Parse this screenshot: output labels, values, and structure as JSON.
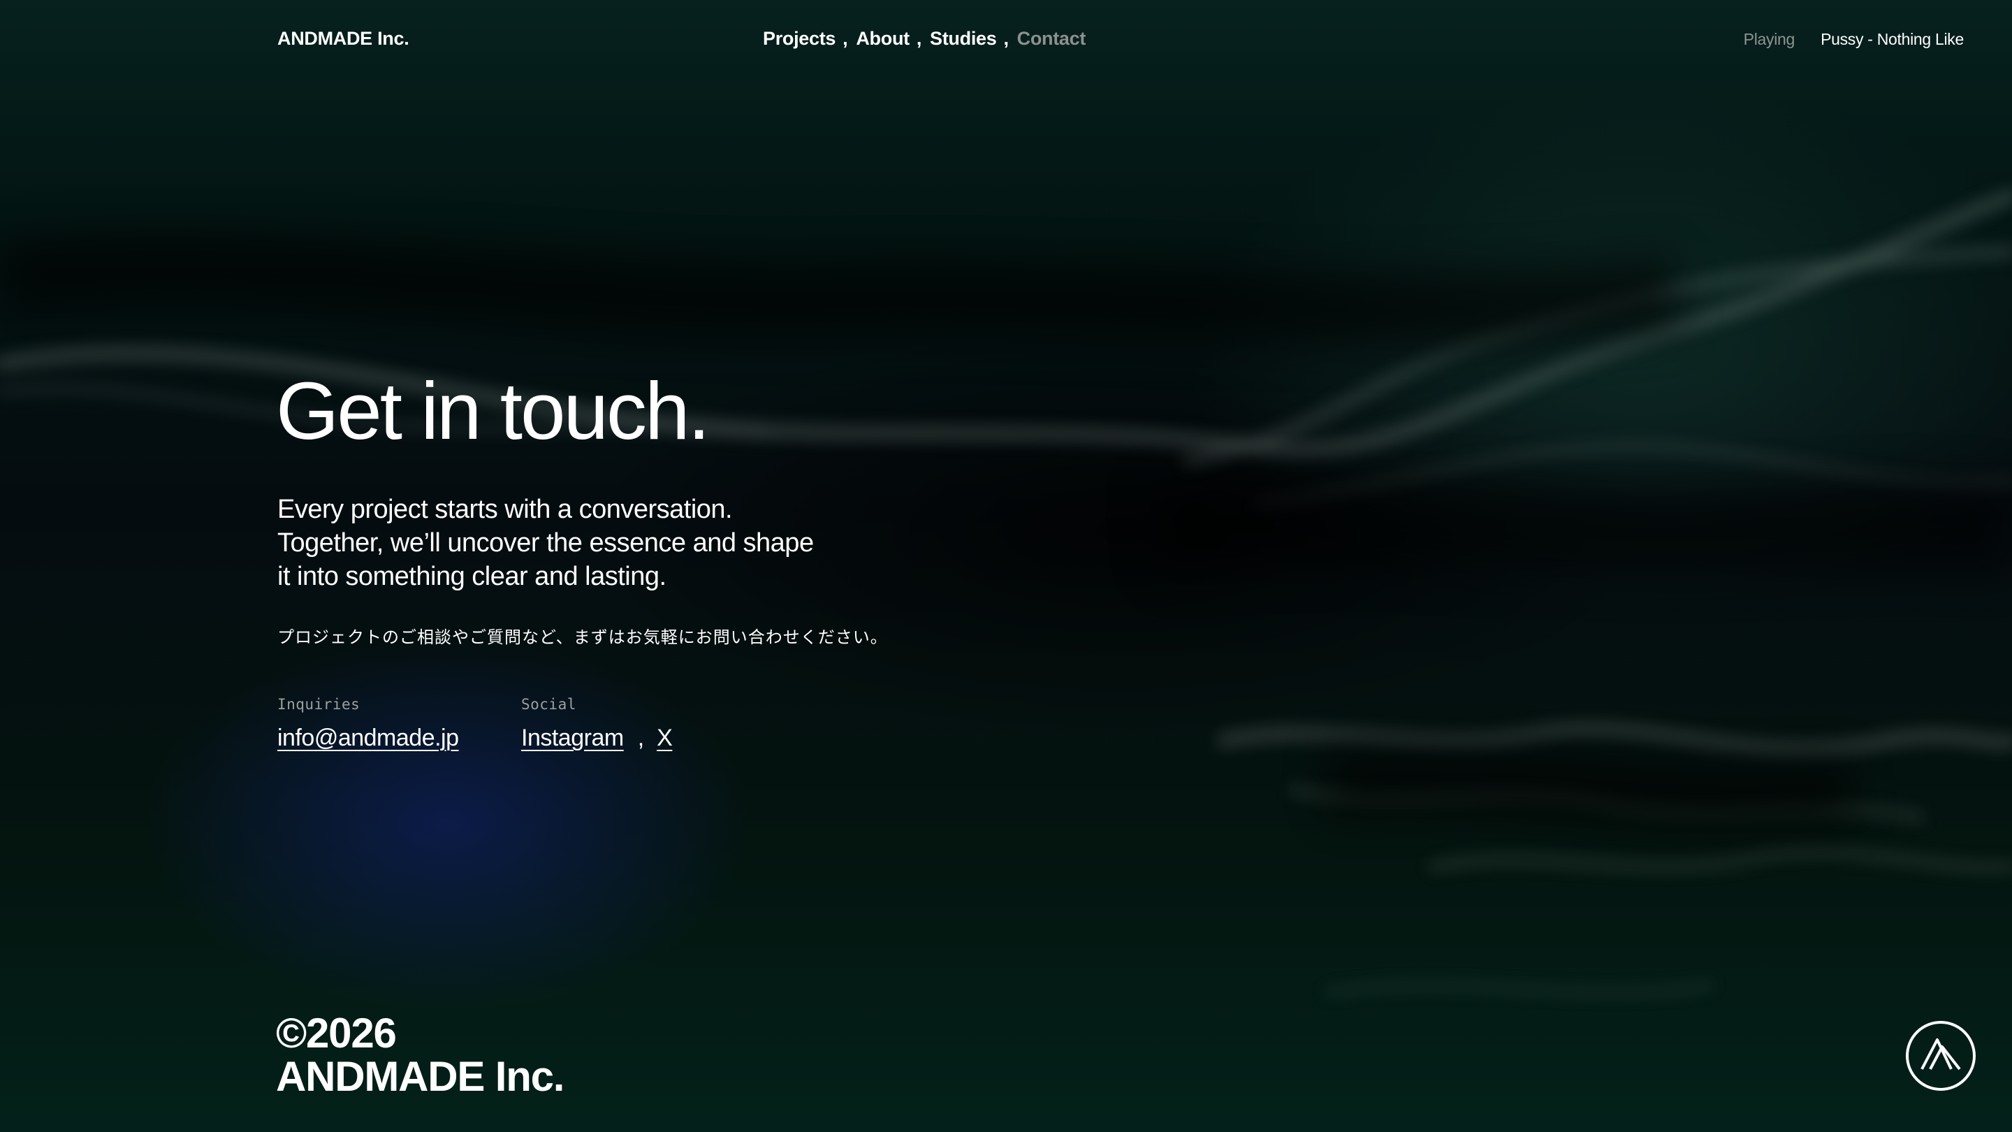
{
  "header": {
    "logo": "ANDMADE Inc.",
    "nav": [
      {
        "label": "Projects"
      },
      {
        "label": "About"
      },
      {
        "label": "Studies"
      },
      {
        "label": "Contact"
      }
    ],
    "nav_separator": ",",
    "player": {
      "label": "Playing",
      "track": "Pussy - Nothing Like"
    }
  },
  "main": {
    "headline": "Get in touch.",
    "lead": [
      "Every project starts with a conversation.",
      "Together, we’ll uncover the essence and shape",
      "it into something clear and lasting."
    ],
    "jp_text": "プロジェクトのご相談やご質問など、まずはお気軽にお問い合わせください。",
    "inquiries": {
      "caption": "Inquiries",
      "email": "info@andmade.jp"
    },
    "social": {
      "caption": "Social",
      "links": [
        "Instagram",
        "X"
      ],
      "separator": ","
    }
  },
  "footer": {
    "copyright": "©2026",
    "company": "ANDMADE Inc."
  },
  "icons": {
    "corner_badge": "andmade-logo-icon"
  },
  "colors": {
    "text": "#ffffff",
    "muted": "#8c918f",
    "background": "#04110f"
  }
}
